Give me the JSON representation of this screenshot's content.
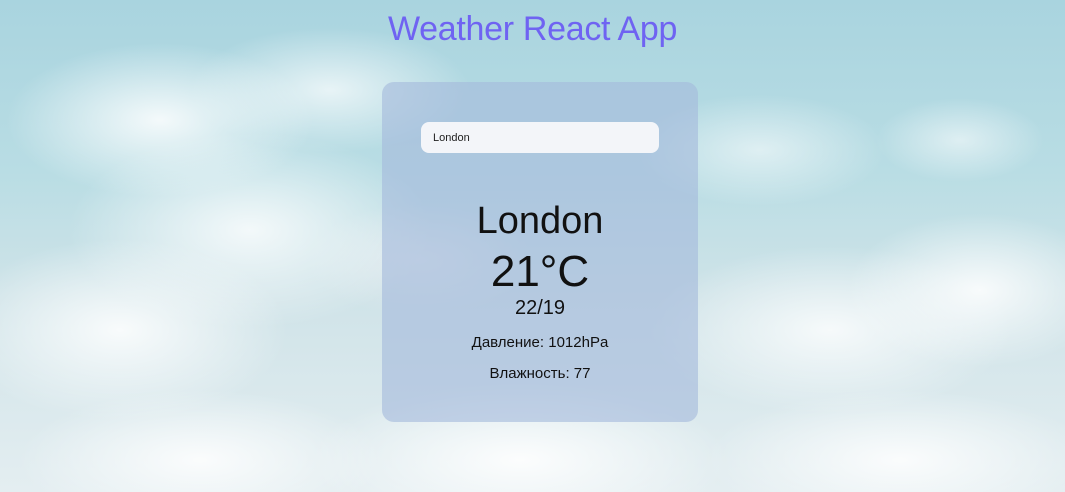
{
  "app": {
    "title": "Weather React App",
    "title_color": "#6f63f2"
  },
  "search": {
    "value": "London",
    "placeholder": ""
  },
  "weather": {
    "city": "London",
    "temperature": "21°C",
    "min_max": "22/19",
    "pressure_label": "Давление:",
    "pressure_value": "1012hPa",
    "humidity_label": "Влажность:",
    "humidity_value": "77"
  }
}
